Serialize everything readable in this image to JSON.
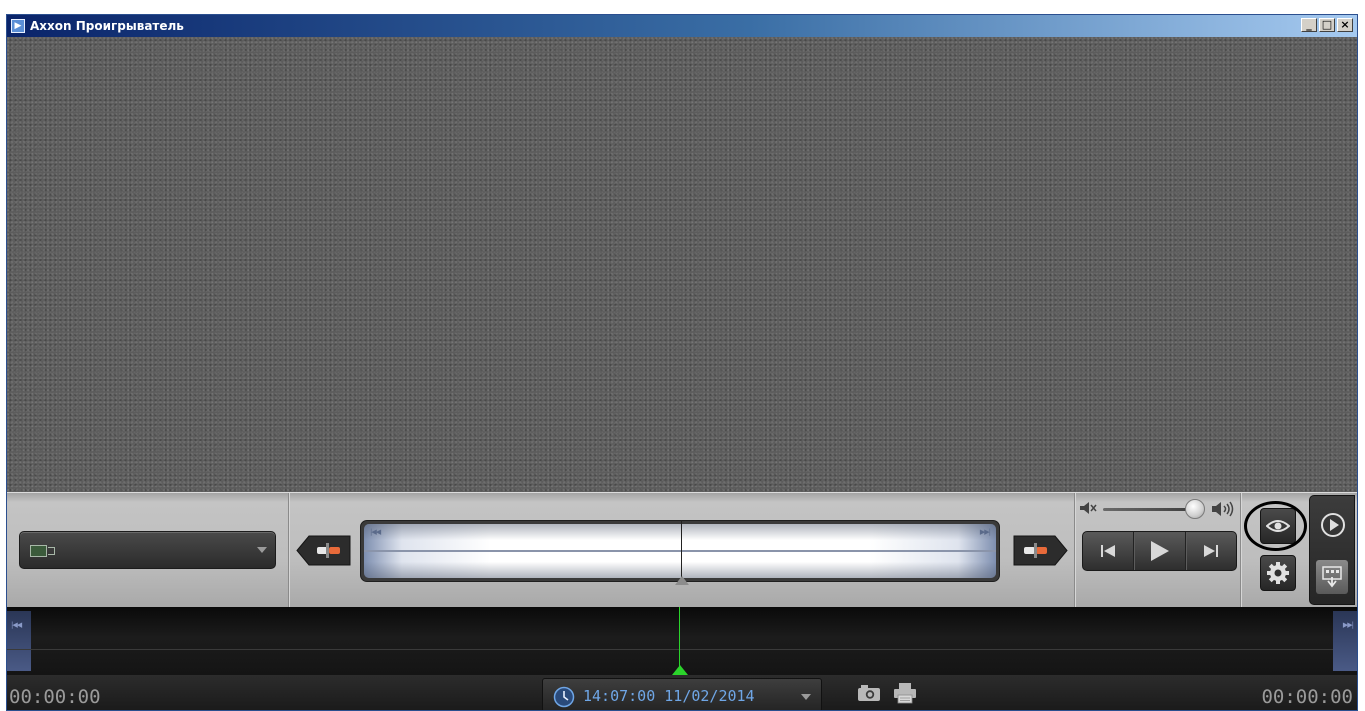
{
  "window": {
    "title": "Axxon Проигрыватель",
    "controls": [
      "minimize",
      "maximize",
      "close"
    ]
  },
  "video": {
    "state": "no-signal"
  },
  "camera_selector": {
    "icon": "camera-icon",
    "selected_value": ""
  },
  "navigation": {
    "prev_icon": "previous-fragment-icon",
    "next_icon": "next-fragment-icon"
  },
  "volume": {
    "level": 0.85,
    "mute_icon": "mute-icon",
    "speaker_icon": "speaker-icon"
  },
  "playback": {
    "buttons": [
      "step-back-icon",
      "play-icon",
      "step-forward-icon"
    ]
  },
  "mode_buttons": {
    "eye_icon": "eye-icon",
    "settings_icon": "gear-icon",
    "play_mode_icon": "play-circle-icon",
    "export_icon": "export-icon"
  },
  "status": {
    "time_left": "00:00:00",
    "time_right": "00:00:00",
    "datetime": "14:07:00 11/02/2014",
    "snapshot_icon": "camera-snapshot-icon",
    "print_icon": "printer-icon"
  },
  "colors": {
    "accent_blue": "#6fa6e6",
    "timeline_cursor": "#2bd42b",
    "title_bar": "#0a246a"
  }
}
